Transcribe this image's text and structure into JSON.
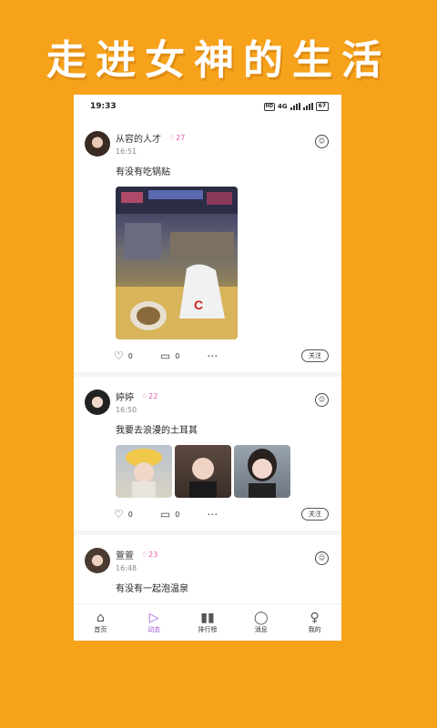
{
  "banner": {
    "title": "走进女神的生活"
  },
  "status_bar": {
    "time": "19:33",
    "network": "4G",
    "battery": "67"
  },
  "posts": [
    {
      "user": "从容的人才",
      "rank": "27",
      "time": "16:51",
      "text": "有没有吃锅贴",
      "likes": "0",
      "comments": "0",
      "follow_label": "关注"
    },
    {
      "user": "婷婷",
      "rank": "22",
      "time": "16:50",
      "text": "我要去浪漫的土耳其",
      "likes": "0",
      "comments": "0",
      "follow_label": "关注"
    },
    {
      "user": "萱萱",
      "rank": "23",
      "time": "16:48",
      "text": "有没有一起泡温泉"
    }
  ],
  "tabbar": {
    "items": [
      {
        "label": "首页",
        "icon": "home-icon"
      },
      {
        "label": "动态",
        "icon": "play-icon"
      },
      {
        "label": "排行榜",
        "icon": "bar-chart-icon"
      },
      {
        "label": "消息",
        "icon": "message-icon"
      },
      {
        "label": "我的",
        "icon": "profile-icon"
      }
    ],
    "active_color": "#a45ad8"
  },
  "colors": {
    "background": "#F7A21B",
    "rank": "#e85aa8"
  }
}
